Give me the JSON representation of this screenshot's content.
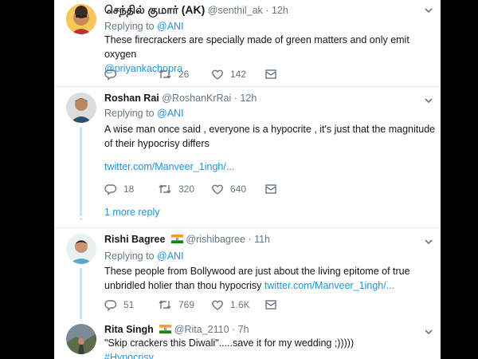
{
  "tweets": [
    {
      "name": "செந்தில் குமார் (AK)",
      "handle": "@senthil_ak",
      "time": "12h",
      "reply_prefix": "Replying to ",
      "reply_to": "@ANI",
      "text": "These firecrackers are specially made of green matters and only emit oxygen",
      "mention": "@priyankachopra",
      "replies": "",
      "retweets": "26",
      "likes": "142"
    },
    {
      "name": "Roshan Rai",
      "handle": "@RoshanKrRai",
      "time": "12h",
      "reply_prefix": "Replying to ",
      "reply_to": "@ANI",
      "text": "A wise man once said , everyone is a hypocrite , it's just that the magnitude of their hypocrisy differs",
      "link": "twitter.com/Manveer_1ingh/...",
      "replies": "18",
      "retweets": "320",
      "likes": "640",
      "more_replies": "1 more reply"
    },
    {
      "name": "Rishi Bagree",
      "handle": "@rishibagree",
      "time": "11h",
      "reply_prefix": "Replying to ",
      "reply_to": "@ANI",
      "text": "These people from Bollywood are just about the living epitome of true unbridled holier than thou hypocrisy",
      "link": "twitter.com/Manveer_1ingh/...",
      "replies": "51",
      "retweets": "769",
      "likes": "1.6K"
    },
    {
      "name": "Rita Singh",
      "handle": "@Rita_2110",
      "time": "7h",
      "text": "\"Skip crackers this Diwali\".....save it for my wedding ;)))))",
      "hashtag": "#Hypocrisy"
    }
  ],
  "colors": {
    "link": "#1b95e0",
    "muted": "#657786",
    "thread": "#c4e6fa"
  },
  "icons": [
    "reply-icon",
    "retweet-icon",
    "like-icon",
    "message-icon",
    "chevron-down-icon",
    "india-flag-icon"
  ]
}
